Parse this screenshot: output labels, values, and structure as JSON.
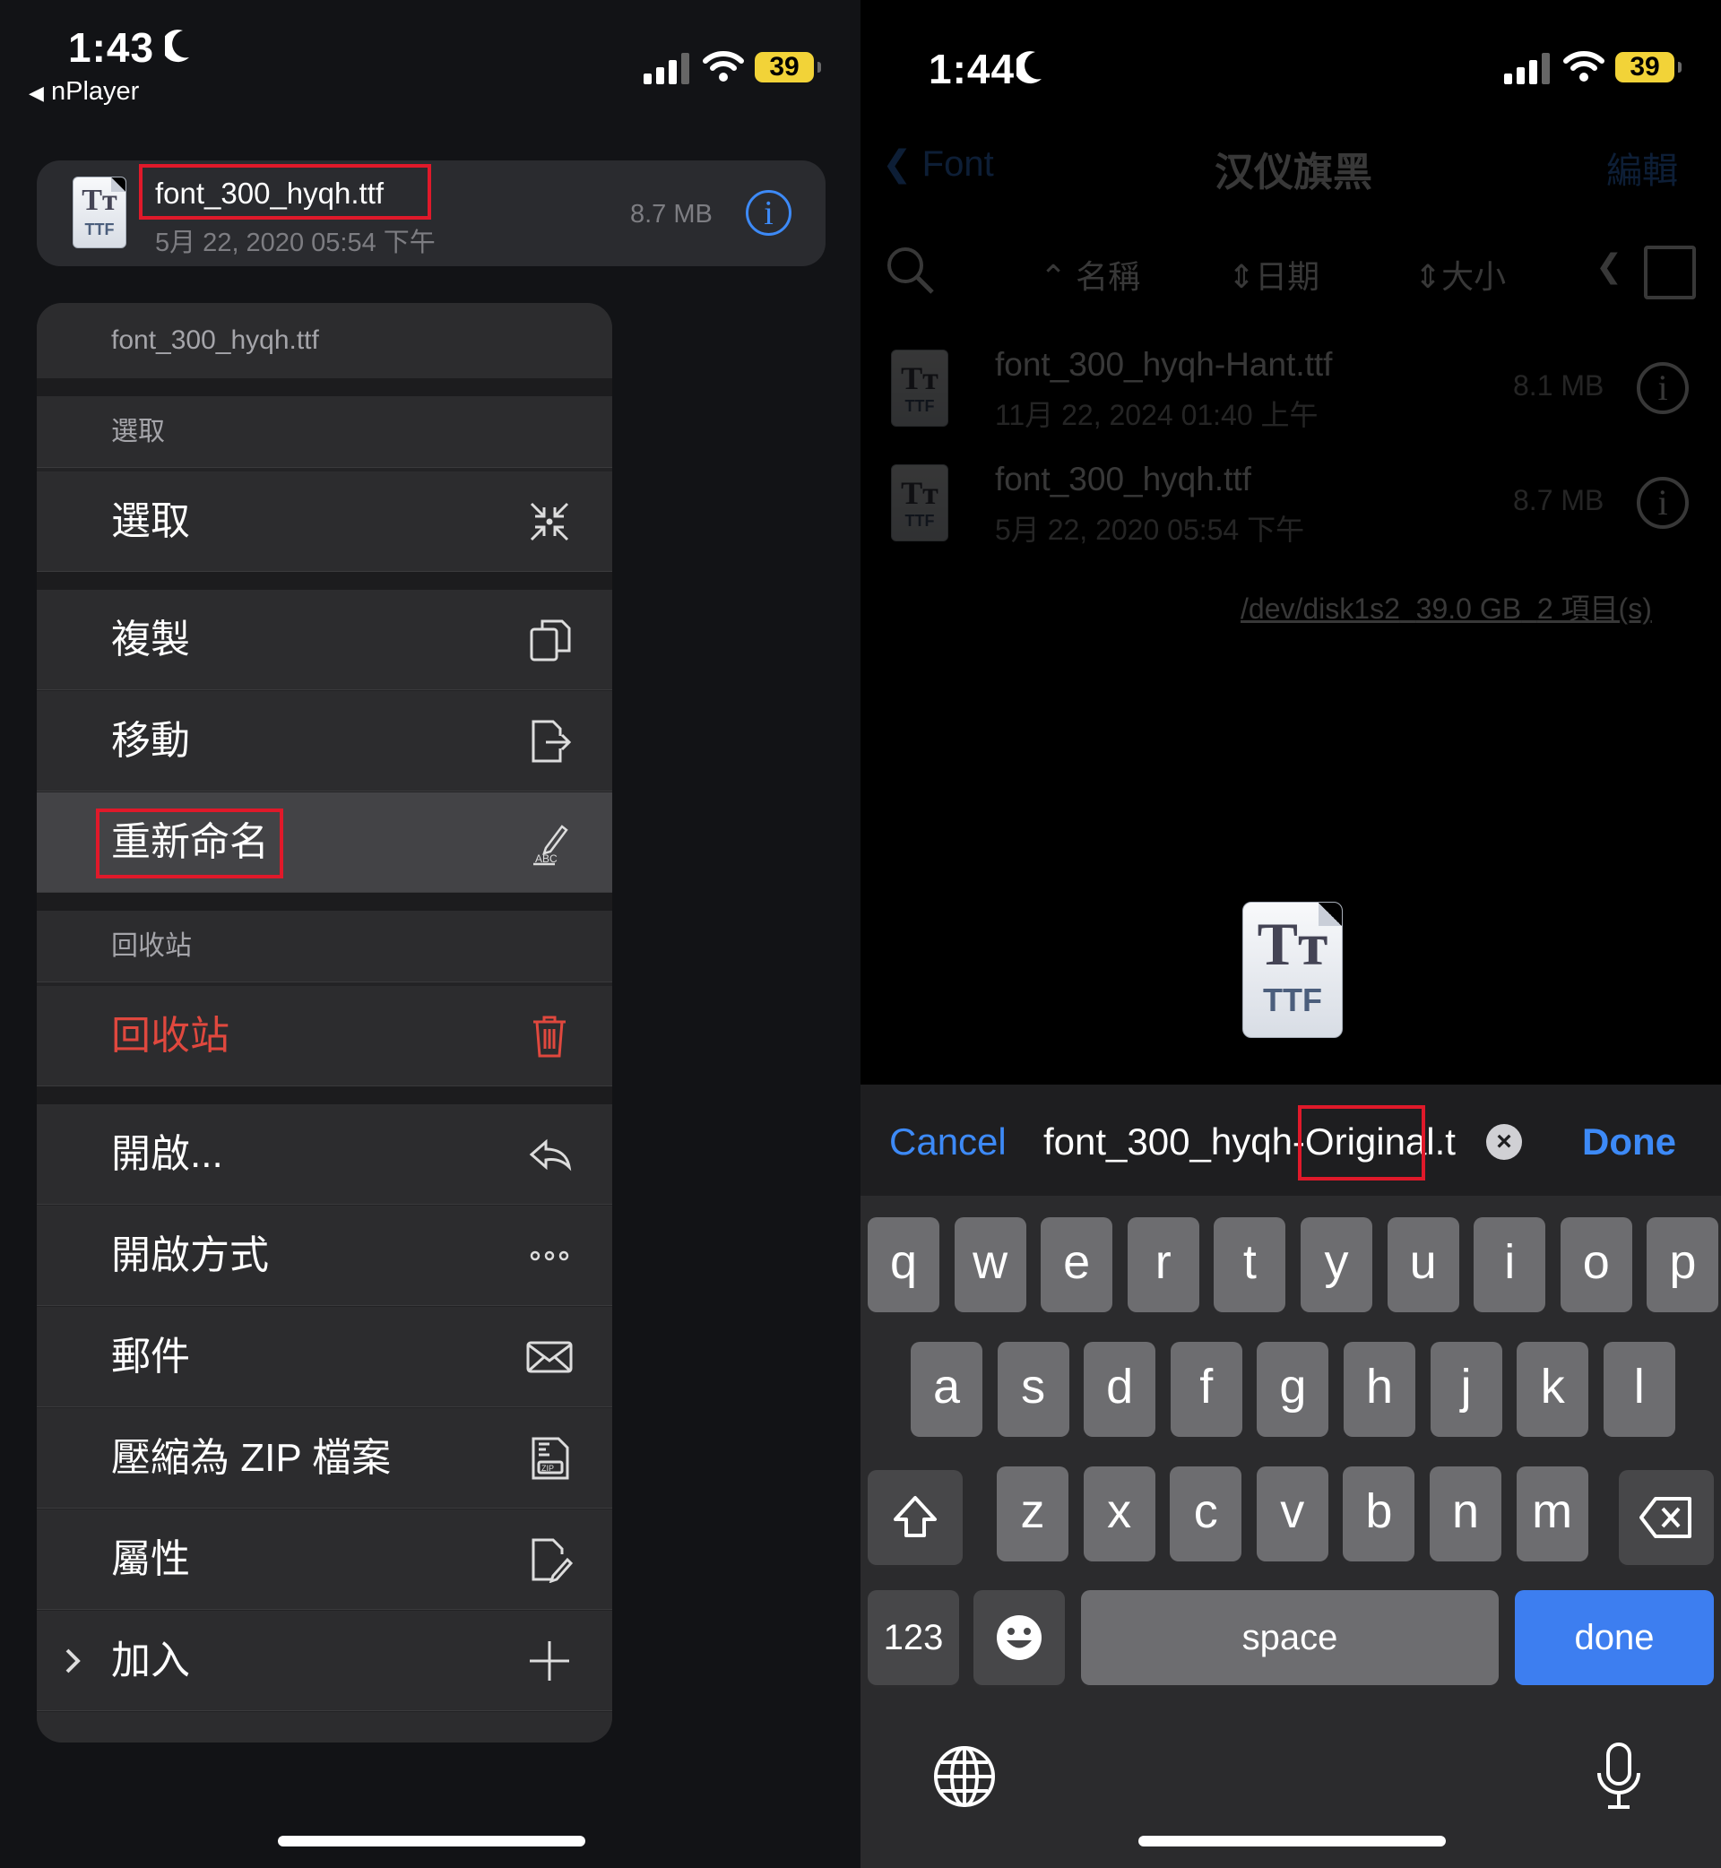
{
  "left": {
    "status": {
      "time": "1:43",
      "back_app": "nPlayer",
      "battery": "39"
    },
    "file_card": {
      "name": "font_300_hyqh.ttf",
      "date": "5月 22, 2020 05:54 下午",
      "size": "8.7 MB",
      "icon_label": "TTF"
    },
    "menu": {
      "title": "font_300_hyqh.ttf",
      "section_select": "選取",
      "select": "選取",
      "copy": "複製",
      "move": "移動",
      "rename": "重新命名",
      "section_trash": "回收站",
      "trash": "回收站",
      "open": "開啟...",
      "open_with": "開啟方式",
      "mail": "郵件",
      "zip": "壓縮為 ZIP 檔案",
      "properties": "屬性",
      "add": "加入",
      "rename_icon_label": "ABC",
      "zip_icon_label": "ZIP"
    }
  },
  "right": {
    "status": {
      "time": "1:44",
      "battery": "39"
    },
    "nav": {
      "back": "Font",
      "title": "汉仪旗黑",
      "edit": "編輯"
    },
    "sort": {
      "name": "名稱",
      "date": "日期",
      "size": "大小"
    },
    "files": [
      {
        "name": "font_300_hyqh-Hant.ttf",
        "date": "11月 22, 2024 01:40 上午",
        "size": "8.1 MB"
      },
      {
        "name": "font_300_hyqh.ttf",
        "date": "5月 22, 2020 05:54 下午",
        "size": "8.7 MB"
      }
    ],
    "footer": {
      "disk": "/dev/disk1s2",
      "free": "39.0 GB",
      "count": "2 項目(s)"
    },
    "preview_label": "TTF",
    "rename_bar": {
      "cancel": "Cancel",
      "done": "Done",
      "text_before": "font_300_hyqh",
      "text_highlight": "-Original",
      "text_after": ".t"
    },
    "keyboard": {
      "row1": [
        "q",
        "w",
        "e",
        "r",
        "t",
        "y",
        "u",
        "i",
        "o",
        "p"
      ],
      "row2": [
        "a",
        "s",
        "d",
        "f",
        "g",
        "h",
        "j",
        "k",
        "l"
      ],
      "row3": [
        "z",
        "x",
        "c",
        "v",
        "b",
        "n",
        "m"
      ],
      "numbers": "123",
      "space": "space",
      "return": "done"
    }
  },
  "colors": {
    "accent": "#3d8af7",
    "destructive": "#e0483e",
    "highlight_box": "#e0192a",
    "battery": "#f2d338"
  }
}
